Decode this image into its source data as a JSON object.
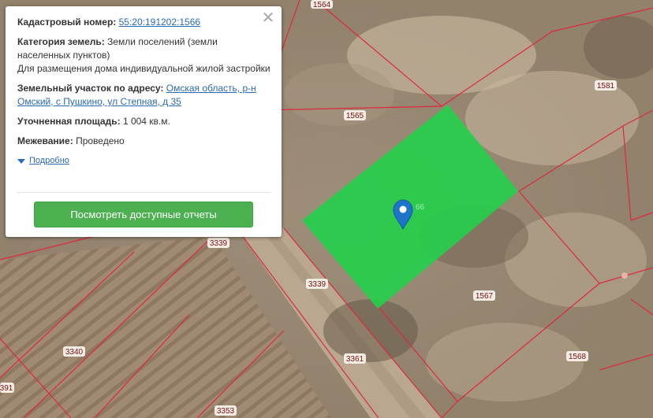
{
  "popup": {
    "cadastral_label": "Кадастровый номер:",
    "cadastral_number": "55:20:191202:1566",
    "category_label": "Категория земель:",
    "category_value": "Земли поселений (земли населенных пунктов)",
    "usage_value": "Для размещения дома индивидуальной жилой застройки",
    "address_label": "Земельный участок по адресу:",
    "address_value": "Омская область, р-н Омский, с Пушкино, ул Степная, д 35",
    "area_label": "Уточненная площадь:",
    "area_value": "1 004 кв.м.",
    "survey_label": "Межевание:",
    "survey_value": "Проведено",
    "details_link": "Подробно",
    "reports_button": "Посмотреть доступные отчеты",
    "close_glyph": "✕"
  },
  "map": {
    "selected_parcel_color": "#22d04a",
    "boundary_color": "#e0283c",
    "marker_color": "#1e74c8",
    "selected_label_partial": "66",
    "labels": {
      "p1564": "1564",
      "p1565": "1565",
      "p1581": "1581",
      "p3339a": "3339",
      "p3339b": "3339",
      "p1567": "1567",
      "p3361": "3361",
      "p1568": "1568",
      "p3340": "3340",
      "p3353": "3353",
      "p391": "391"
    }
  }
}
